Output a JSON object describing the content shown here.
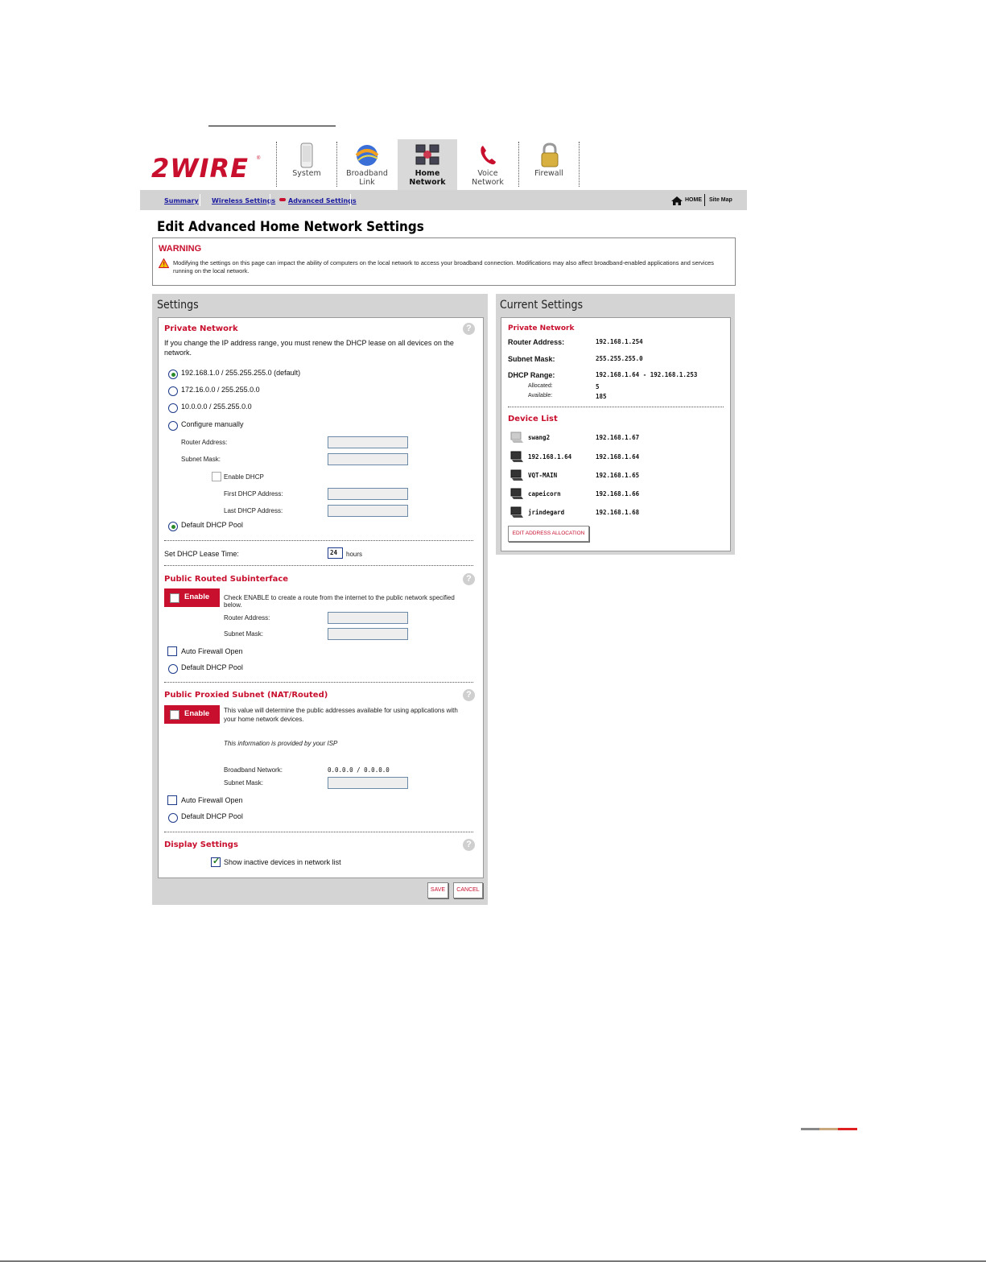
{
  "nav": {
    "tabs": [
      {
        "label_line1": "System",
        "label_line2": ""
      },
      {
        "label_line1": "Broadband",
        "label_line2": "Link"
      },
      {
        "label_line1": "Home",
        "label_line2": "Network"
      },
      {
        "label_line1": "Voice",
        "label_line2": "Network"
      },
      {
        "label_line1": "Firewall",
        "label_line2": ""
      }
    ],
    "logo_text": "2WIRE",
    "subnav": [
      "Summary",
      "Wireless Settings",
      "Advanced Settings"
    ],
    "home_label": "HOME",
    "sitemap_label": "Site Map"
  },
  "page": {
    "title": "Edit Advanced Home Network Settings"
  },
  "warning": {
    "title": "WARNING",
    "text": "Modifying the settings on this page can impact the ability of computers on the local network to access your broadband connection. Modifications may also affect broadband-enabled applications and services running on the local network."
  },
  "settings": {
    "title": "Settings",
    "private_network": {
      "title": "Private Network",
      "description": "If you change the IP address range, you must renew the DHCP lease on all devices on the network.",
      "options": [
        "192.168.1.0 / 255.255.255.0 (default)",
        "172.16.0.0 / 255.255.0.0",
        "10.0.0.0 / 255.255.0.0",
        "Configure manually"
      ],
      "selected": "192.168.1.0 / 255.255.255.0 (default)",
      "router_address_label": "Router Address:",
      "subnet_mask_label": "Subnet Mask:",
      "enable_dhcp_label": "Enable DHCP",
      "first_dhcp_label": "First DHCP Address:",
      "last_dhcp_label": "Last DHCP Address:",
      "default_pool_label": "Default DHCP Pool"
    },
    "lease": {
      "label": "Set DHCP Lease Time:",
      "value": "24",
      "unit": "hours"
    },
    "public_routed": {
      "title": "Public Routed Subinterface",
      "enable_label": "Enable",
      "description": "Check ENABLE to create a route from the internet to the public network specified below.",
      "router_address_label": "Router Address:",
      "subnet_mask_label": "Subnet Mask:",
      "auto_firewall_label": "Auto Firewall Open",
      "default_pool_label": "Default DHCP Pool"
    },
    "public_proxied": {
      "title": "Public Proxied Subnet (NAT/Routed)",
      "enable_label": "Enable",
      "description": "This value will determine the public addresses available for using applications with your home network devices.",
      "isp_note": "This information is provided by your ISP",
      "broadband_network_label": "Broadband Network:",
      "broadband_network_value": "0.0.0.0 / 0.0.0.0",
      "subnet_mask_label": "Subnet Mask:",
      "auto_firewall_label": "Auto Firewall Open",
      "default_pool_label": "Default DHCP Pool"
    },
    "display": {
      "title": "Display Settings",
      "show_inactive_label": "Show inactive devices in network list",
      "show_inactive_checked": true
    },
    "save_label": "SAVE",
    "cancel_label": "CANCEL"
  },
  "current": {
    "title": "Current Settings",
    "private_network_title": "Private Network",
    "router_address_label": "Router Address:",
    "router_address": "192.168.1.254",
    "subnet_mask_label": "Subnet Mask:",
    "subnet_mask": "255.255.255.0",
    "dhcp_range_label": "DHCP Range:",
    "dhcp_range": "192.168.1.64 - 192.168.1.253",
    "allocated_label": "Allocated:",
    "allocated": "5",
    "available_label": "Available:",
    "available": "185",
    "device_list_title": "Device List",
    "devices": [
      {
        "name": "swang2",
        "ip": "192.168.1.67",
        "active": false
      },
      {
        "name": "192.168.1.64",
        "ip": "192.168.1.64",
        "active": true
      },
      {
        "name": "VQT-MAIN",
        "ip": "192.168.1.65",
        "active": true
      },
      {
        "name": "capeicorn",
        "ip": "192.168.1.66",
        "active": true
      },
      {
        "name": "jrindegard",
        "ip": "192.168.1.68",
        "active": true
      }
    ],
    "edit_allocation_label": "EDIT ADDRESS ALLOCATION"
  },
  "colors": {
    "brand_red": "#c8102e",
    "panel_grey": "#d4d4d4",
    "link_blue": "#1a1aa0"
  }
}
